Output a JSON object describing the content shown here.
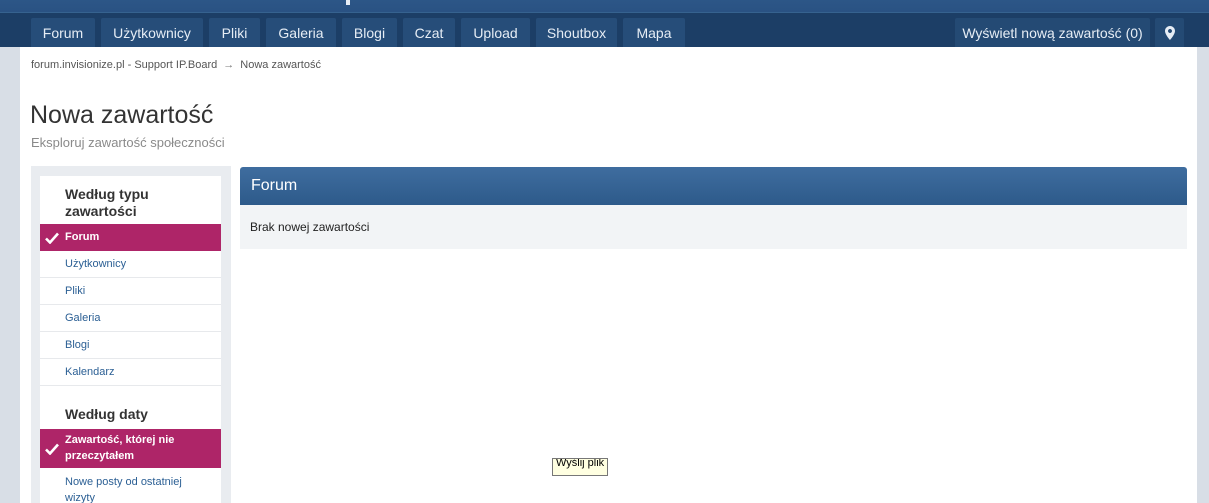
{
  "nav": {
    "items": [
      {
        "label": "Forum"
      },
      {
        "label": "Użytkownicy"
      },
      {
        "label": "Pliki"
      },
      {
        "label": "Galeria"
      },
      {
        "label": "Blogi"
      },
      {
        "label": "Czat"
      },
      {
        "label": "Upload"
      },
      {
        "label": "Shoutbox"
      },
      {
        "label": "Mapa"
      }
    ],
    "new_content_label": "Wyświetl nową zawartość (0)",
    "pin_icon": "map-pin-icon"
  },
  "breadcrumb": {
    "home": "forum.invisionize.pl - Support IP.Board",
    "separator": "→",
    "current": "Nowa zawartość"
  },
  "page": {
    "title": "Nowa zawartość",
    "subtitle": "Eksploruj zawartość społeczności"
  },
  "sidebar": {
    "type_heading": "Według typu zawartości",
    "type_items": [
      {
        "label": "Forum",
        "active": true
      },
      {
        "label": "Użytkownicy"
      },
      {
        "label": "Pliki"
      },
      {
        "label": "Galeria"
      },
      {
        "label": "Blogi"
      },
      {
        "label": "Kalendarz"
      }
    ],
    "date_heading": "Według daty",
    "date_items": [
      {
        "label": "Zawartość, której nie przeczytałem",
        "active": true
      },
      {
        "label": "Nowe posty od ostatniej wizyty"
      }
    ]
  },
  "panel": {
    "title": "Forum",
    "empty_message": "Brak nowej zawartości"
  },
  "tooltip": {
    "text": "Wyślij plik"
  },
  "colors": {
    "nav_bg": "#1c3e66",
    "active_item": "#ae2568",
    "panel_header": "#2d5a8a",
    "link": "#2b5f94"
  }
}
